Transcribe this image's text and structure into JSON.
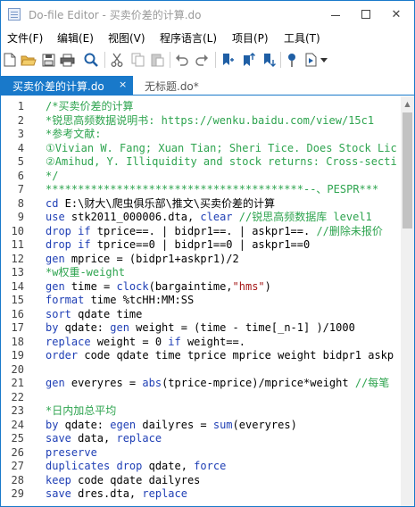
{
  "window": {
    "title": "Do-file Editor - 买卖价差的计算.do"
  },
  "menu": [
    "文件(F)",
    "编辑(E)",
    "视图(V)",
    "程序语言(L)",
    "项目(P)",
    "工具(T)"
  ],
  "tabs": [
    {
      "label": "买卖价差的计算.do",
      "close": "×",
      "active": true
    },
    {
      "label": "无标题.do*",
      "active": false
    }
  ],
  "lines": [
    {
      "n": "1",
      "parts": [
        {
          "c": "cmt",
          "t": "/*买卖价差的计算"
        }
      ]
    },
    {
      "n": "2",
      "parts": [
        {
          "c": "cmt",
          "t": "*锐思高频数据说明书: https://wenku.baidu.com/view/15c1"
        }
      ]
    },
    {
      "n": "3",
      "parts": [
        {
          "c": "cmt",
          "t": "*参考文献:"
        }
      ]
    },
    {
      "n": "4",
      "parts": [
        {
          "c": "cmt",
          "t": "①Vivian W. Fang; Xuan Tian; Sheri Tice. Does Stock Lic"
        }
      ]
    },
    {
      "n": "5",
      "parts": [
        {
          "c": "cmt",
          "t": "②Amihud, Y. Illiquidity and stock returns: Cross-secti"
        }
      ]
    },
    {
      "n": "6",
      "parts": [
        {
          "c": "cmt",
          "t": "*/"
        }
      ]
    },
    {
      "n": "7",
      "parts": [
        {
          "c": "cmt",
          "t": "****************************************--、PESPR***"
        }
      ]
    },
    {
      "n": "8",
      "parts": [
        {
          "c": "kw",
          "t": "cd"
        },
        {
          "c": "pl",
          "t": " E:\\财大\\爬虫俱乐部\\推文\\买卖价差的计算"
        }
      ]
    },
    {
      "n": "9",
      "parts": [
        {
          "c": "kw",
          "t": "use"
        },
        {
          "c": "pl",
          "t": " stk2011_000006.dta, "
        },
        {
          "c": "kw",
          "t": "clear"
        },
        {
          "c": "cmt",
          "t": " //锐思高频数据库 level1"
        }
      ]
    },
    {
      "n": "10",
      "parts": [
        {
          "c": "kw",
          "t": "drop if"
        },
        {
          "c": "pl",
          "t": " tprice==. | bidpr1==. | askpr1==. "
        },
        {
          "c": "cmt",
          "t": "//删除未报价"
        }
      ]
    },
    {
      "n": "11",
      "parts": [
        {
          "c": "kw",
          "t": "drop if"
        },
        {
          "c": "pl",
          "t": " tprice==0 | bidpr1==0 | askpr1==0"
        }
      ]
    },
    {
      "n": "12",
      "parts": [
        {
          "c": "kw",
          "t": "gen"
        },
        {
          "c": "pl",
          "t": " mprice = (bidpr1+askpr1)/2"
        }
      ]
    },
    {
      "n": "13",
      "parts": [
        {
          "c": "cmt",
          "t": "*w权重-weight"
        }
      ]
    },
    {
      "n": "14",
      "parts": [
        {
          "c": "kw",
          "t": "gen"
        },
        {
          "c": "pl",
          "t": " time = "
        },
        {
          "c": "fn",
          "t": "clock"
        },
        {
          "c": "pl",
          "t": "(bargaintime,"
        },
        {
          "c": "str",
          "t": "\"hms\""
        },
        {
          "c": "pl",
          "t": ")"
        }
      ]
    },
    {
      "n": "15",
      "parts": [
        {
          "c": "kw",
          "t": "format"
        },
        {
          "c": "pl",
          "t": " time %tcHH:MM:SS"
        }
      ]
    },
    {
      "n": "16",
      "parts": [
        {
          "c": "kw",
          "t": "sort"
        },
        {
          "c": "pl",
          "t": " qdate time"
        }
      ]
    },
    {
      "n": "17",
      "parts": [
        {
          "c": "kw",
          "t": "by"
        },
        {
          "c": "pl",
          "t": " qdate: "
        },
        {
          "c": "kw",
          "t": "gen"
        },
        {
          "c": "pl",
          "t": " weight = (time - time[_n-1] )/1000"
        }
      ]
    },
    {
      "n": "18",
      "parts": [
        {
          "c": "kw",
          "t": "replace"
        },
        {
          "c": "pl",
          "t": " weight = 0 "
        },
        {
          "c": "kw",
          "t": "if"
        },
        {
          "c": "pl",
          "t": " weight==."
        }
      ]
    },
    {
      "n": "19",
      "parts": [
        {
          "c": "kw",
          "t": "order"
        },
        {
          "c": "pl",
          "t": " code qdate time tprice mprice weight bidpr1 askp"
        }
      ]
    },
    {
      "n": "20",
      "parts": [
        {
          "c": "pl",
          "t": ""
        }
      ]
    },
    {
      "n": "21",
      "parts": [
        {
          "c": "kw",
          "t": "gen"
        },
        {
          "c": "pl",
          "t": " everyres = "
        },
        {
          "c": "fn",
          "t": "abs"
        },
        {
          "c": "pl",
          "t": "(tprice-mprice)/mprice*weight "
        },
        {
          "c": "cmt",
          "t": "//每笔"
        }
      ]
    },
    {
      "n": "22",
      "parts": [
        {
          "c": "pl",
          "t": ""
        }
      ]
    },
    {
      "n": "23",
      "parts": [
        {
          "c": "cmt",
          "t": "*日内加总平均"
        }
      ]
    },
    {
      "n": "24",
      "parts": [
        {
          "c": "kw",
          "t": "by"
        },
        {
          "c": "pl",
          "t": " qdate: "
        },
        {
          "c": "kw",
          "t": "egen"
        },
        {
          "c": "pl",
          "t": " dailyres = "
        },
        {
          "c": "fn",
          "t": "sum"
        },
        {
          "c": "pl",
          "t": "(everyres)"
        }
      ]
    },
    {
      "n": "25",
      "parts": [
        {
          "c": "kw",
          "t": "save"
        },
        {
          "c": "pl",
          "t": " data, "
        },
        {
          "c": "kw",
          "t": "replace"
        }
      ]
    },
    {
      "n": "26",
      "parts": [
        {
          "c": "kw",
          "t": "preserve"
        }
      ]
    },
    {
      "n": "27",
      "parts": [
        {
          "c": "kw",
          "t": "duplicates drop"
        },
        {
          "c": "pl",
          "t": " qdate, "
        },
        {
          "c": "kw",
          "t": "force"
        }
      ]
    },
    {
      "n": "28",
      "parts": [
        {
          "c": "kw",
          "t": "keep"
        },
        {
          "c": "pl",
          "t": " code qdate dailyres"
        }
      ]
    },
    {
      "n": "29",
      "parts": [
        {
          "c": "kw",
          "t": "save"
        },
        {
          "c": "pl",
          "t": " dres.dta, "
        },
        {
          "c": "kw",
          "t": "replace"
        }
      ]
    }
  ]
}
